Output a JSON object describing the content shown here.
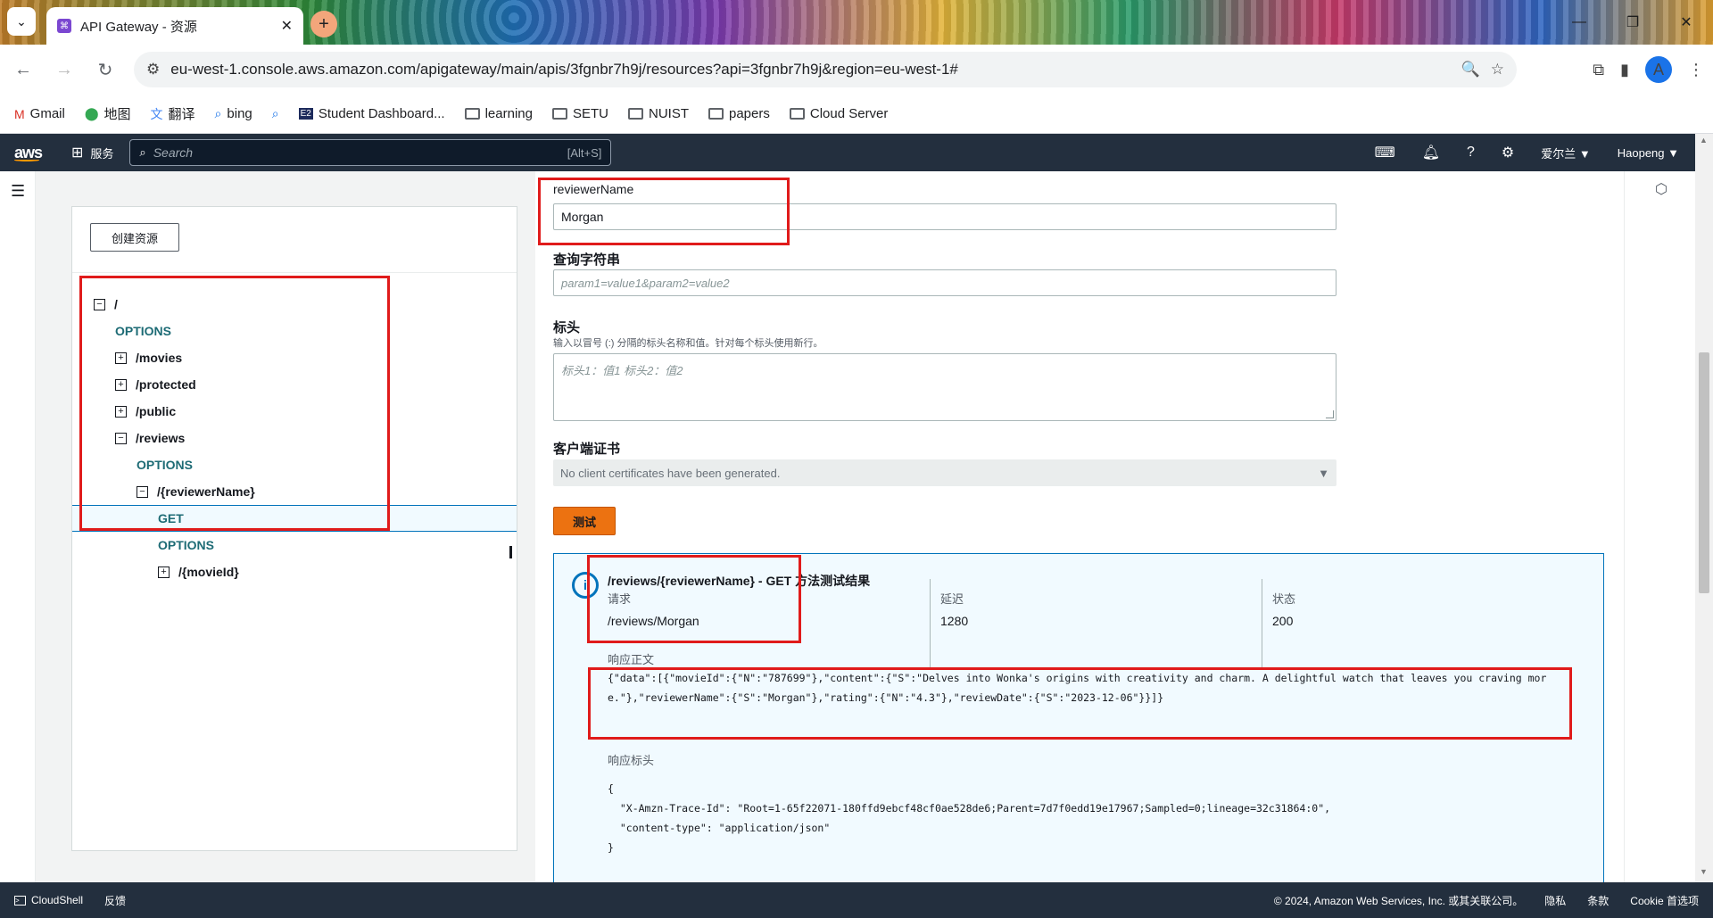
{
  "browser": {
    "tab_title": "API Gateway - 资源",
    "url": "eu-west-1.console.aws.amazon.com/apigateway/main/apis/3fgnbr7h9j/resources?api=3fgnbr7h9j&region=eu-west-1#",
    "profile_initial": "A",
    "bookmarks": [
      {
        "label": "Gmail",
        "icon": "gmail-icon"
      },
      {
        "label": "地图",
        "icon": "maps-icon"
      },
      {
        "label": "翻译",
        "icon": "translate-icon"
      },
      {
        "label": "bing",
        "icon": "search-icon"
      },
      {
        "label": "",
        "icon": "search-icon"
      },
      {
        "label": "Student Dashboard...",
        "icon": "e2-icon"
      },
      {
        "label": "learning",
        "icon": "folder-icon"
      },
      {
        "label": "SETU",
        "icon": "folder-icon"
      },
      {
        "label": "NUIST",
        "icon": "folder-icon"
      },
      {
        "label": "papers",
        "icon": "folder-icon"
      },
      {
        "label": "Cloud Server",
        "icon": "folder-icon"
      }
    ]
  },
  "aws_header": {
    "logo": "aws",
    "services": "服务",
    "search_placeholder": "Search",
    "search_shortcut": "[Alt+S]",
    "region": "爱尔兰 ▼",
    "user": "Haopeng ▼"
  },
  "tree": {
    "create_button": "创建资源",
    "nodes": [
      {
        "label": "/",
        "type": "resource",
        "toggle": "−"
      },
      {
        "label": "OPTIONS",
        "type": "method"
      },
      {
        "label": "/movies",
        "type": "resource",
        "toggle": "+"
      },
      {
        "label": "/protected",
        "type": "resource",
        "toggle": "+"
      },
      {
        "label": "/public",
        "type": "resource",
        "toggle": "+"
      },
      {
        "label": "/reviews",
        "type": "resource",
        "toggle": "−"
      },
      {
        "label": "OPTIONS",
        "type": "method"
      },
      {
        "label": "/{reviewerName}",
        "type": "resource",
        "toggle": "−"
      },
      {
        "label": "GET",
        "type": "method",
        "selected": true
      },
      {
        "label": "OPTIONS",
        "type": "method"
      },
      {
        "label": "/{movieId}",
        "type": "resource",
        "toggle": "+"
      }
    ]
  },
  "test_form": {
    "path_param_label": "reviewerName",
    "path_param_value": "Morgan",
    "query_label": "查询字符串",
    "query_placeholder": "param1=value1&param2=value2",
    "headers_label": "标头",
    "headers_hint": "输入以冒号 (:) 分隔的标头名称和值。针对每个标头使用新行。",
    "headers_placeholder": "标头1：值1 标头2：值2",
    "cert_label": "客户端证书",
    "cert_value": "No client certificates have been generated.",
    "test_button": "测试"
  },
  "results": {
    "title": "/reviews/{reviewerName} - GET 方法测试结果",
    "request_label": "请求",
    "request_value": "/reviews/Morgan",
    "latency_label": "延迟",
    "latency_value": "1280",
    "status_label": "状态",
    "status_value": "200",
    "body_label": "响应正文",
    "body": "{\"data\":[{\"movieId\":{\"N\":\"787699\"},\"content\":{\"S\":\"Delves into Wonka's origins with creativity and charm. A delightful watch that leaves you craving more.\"},\"reviewerName\":{\"S\":\"Morgan\"},\"rating\":{\"N\":\"4.3\"},\"reviewDate\":{\"S\":\"2023-12-06\"}}]}",
    "headers_label": "响应标头",
    "headers_body": "{\n  \"X-Amzn-Trace-Id\": \"Root=1-65f22071-180ffd9ebcf48cf0ae528de6;Parent=7d7f0edd19e17967;Sampled=0;lineage=32c31864:0\",\n  \"content-type\": \"application/json\"\n}"
  },
  "footer": {
    "cloudshell": "CloudShell",
    "feedback": "反馈",
    "copyright": "© 2024, Amazon Web Services, Inc. 或其关联公司。",
    "privacy": "隐私",
    "terms": "条款",
    "cookie": "Cookie 首选项"
  },
  "colors": {
    "aws_nav": "#232f3e",
    "accent_orange": "#ec7211",
    "method_teal": "#1d6b75",
    "highlight_red": "#e01b1b",
    "info_blue": "#0073bb"
  }
}
